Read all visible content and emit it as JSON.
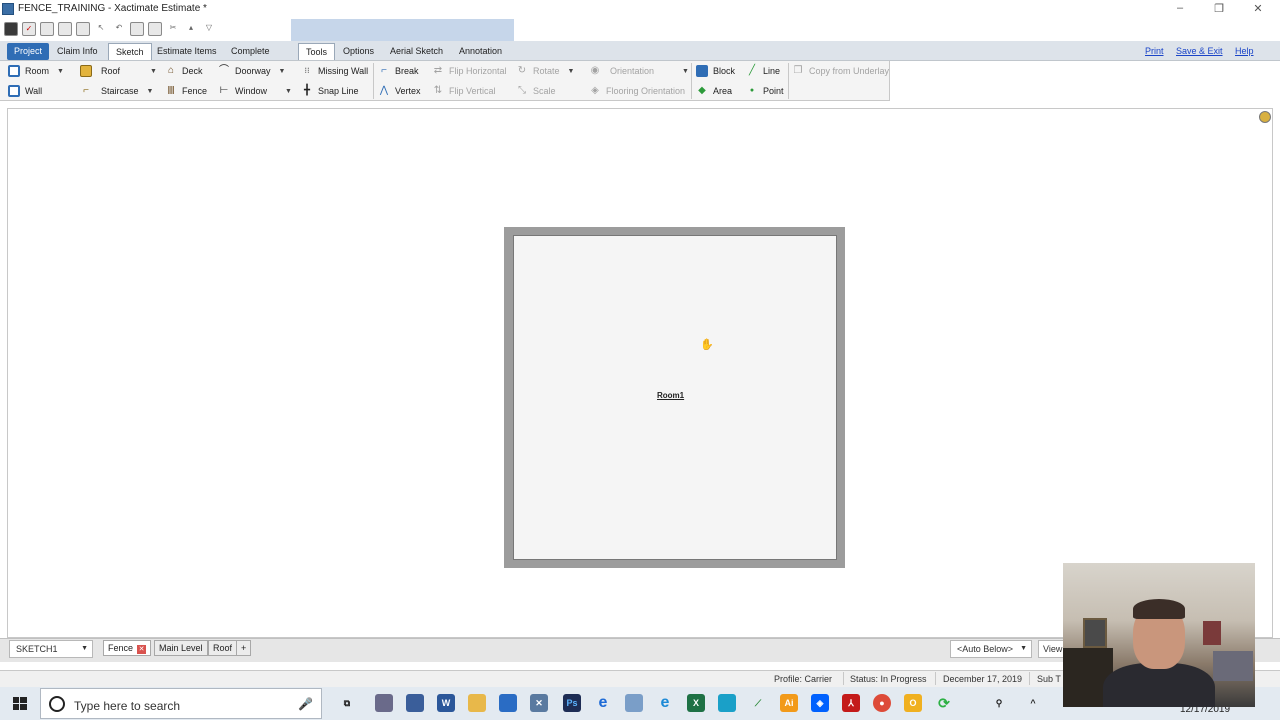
{
  "window": {
    "title": "FENCE_TRAINING - Xactimate Estimate *"
  },
  "menu_tabs": [
    {
      "label": "Project",
      "state": "blue"
    },
    {
      "label": "Claim Info",
      "state": "normal"
    },
    {
      "label": "Sketch",
      "state": "selected"
    },
    {
      "label": "Estimate Items",
      "state": "normal"
    },
    {
      "label": "Complete",
      "state": "normal"
    },
    {
      "label": "Tools",
      "state": "selected"
    },
    {
      "label": "Options",
      "state": "normal"
    },
    {
      "label": "Aerial Sketch",
      "state": "normal"
    },
    {
      "label": "Annotation",
      "state": "normal"
    }
  ],
  "right_links": {
    "print": "Print",
    "save_exit": "Save & Exit",
    "help": "Help"
  },
  "ribbon": {
    "room": "Room",
    "wall": "Wall",
    "roof": "Roof",
    "staircase": "Staircase",
    "deck": "Deck",
    "fence": "Fence",
    "doorway": "Doorway",
    "window": "Window",
    "missing_wall": "Missing Wall",
    "snap_line": "Snap Line",
    "break": "Break",
    "vertex": "Vertex",
    "flip_horizontal": "Flip Horizontal",
    "flip_vertical": "Flip Vertical",
    "rotate": "Rotate",
    "scale": "Scale",
    "orientation": "Orientation",
    "flooring_orientation": "Flooring Orientation",
    "block": "Block",
    "area": "Area",
    "line": "Line",
    "point": "Point",
    "copy_from_underlay": "Copy from Underlay"
  },
  "canvas": {
    "room_label": "Room1"
  },
  "bottom": {
    "sketch_select": "SKETCH1",
    "level_tabs": [
      "Fence",
      "Main Level",
      "Roof"
    ],
    "add_tab": "+",
    "auto_below": "<Auto Below>",
    "view": "View"
  },
  "status": {
    "profile": "Profile: Carrier",
    "status": "Status: In Progress",
    "date": "December 17, 2019",
    "sub": "Sub T"
  },
  "taskbar": {
    "search_placeholder": "Type here to search",
    "clock_date": "12/17/2019"
  },
  "colors": {
    "accent": "#2f6db5",
    "ribbon_highlight": "#c6d6ea",
    "link": "#1a44c8"
  }
}
